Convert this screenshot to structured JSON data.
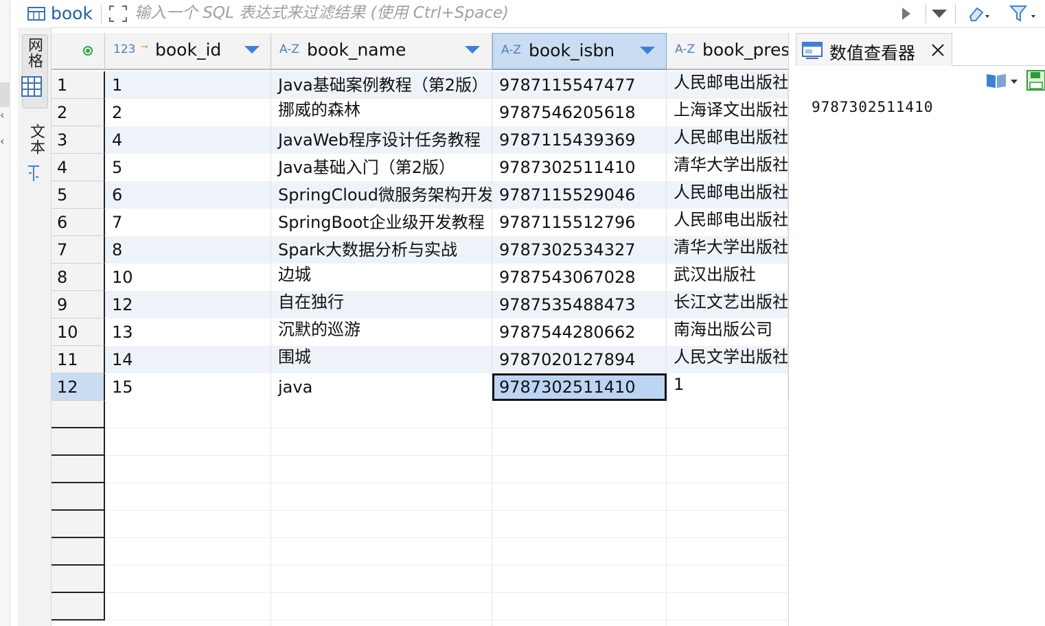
{
  "toolbar": {
    "table_name": "book",
    "filter_placeholder": "输入一个 SQL 表达式来过滤结果 (使用 Ctrl+Space)"
  },
  "side_tabs": {
    "grid_label": "网格",
    "text_label": "文本"
  },
  "columns": [
    {
      "type": "123",
      "name": "book_id",
      "key": true
    },
    {
      "type": "A-Z",
      "name": "book_name"
    },
    {
      "type": "A-Z",
      "name": "book_isbn"
    },
    {
      "type": "A-Z",
      "name": "book_pres"
    }
  ],
  "rows": [
    {
      "num": "1",
      "book_id": "1",
      "book_name": "Java基础案例教程（第2版）",
      "book_isbn": "9787115547477",
      "book_press": "人民邮电出版社"
    },
    {
      "num": "2",
      "book_id": "2",
      "book_name": "挪威的森林",
      "book_isbn": "9787546205618",
      "book_press": "上海译文出版社"
    },
    {
      "num": "3",
      "book_id": "4",
      "book_name": "JavaWeb程序设计任务教程",
      "book_isbn": "9787115439369",
      "book_press": "人民邮电出版社"
    },
    {
      "num": "4",
      "book_id": "5",
      "book_name": "Java基础入门（第2版）",
      "book_isbn": "9787302511410",
      "book_press": "清华大学出版社"
    },
    {
      "num": "5",
      "book_id": "6",
      "book_name": "SpringCloud微服务架构开发",
      "book_isbn": "9787115529046",
      "book_press": "人民邮电出版社"
    },
    {
      "num": "6",
      "book_id": "7",
      "book_name": "SpringBoot企业级开发教程",
      "book_isbn": "9787115512796",
      "book_press": "人民邮电出版社"
    },
    {
      "num": "7",
      "book_id": "8",
      "book_name": "Spark大数据分析与实战",
      "book_isbn": "9787302534327",
      "book_press": "清华大学出版社"
    },
    {
      "num": "8",
      "book_id": "10",
      "book_name": "边城",
      "book_isbn": "9787543067028",
      "book_press": "武汉出版社"
    },
    {
      "num": "9",
      "book_id": "12",
      "book_name": "自在独行",
      "book_isbn": "9787535488473",
      "book_press": "长江文艺出版社"
    },
    {
      "num": "10",
      "book_id": "13",
      "book_name": "沉默的巡游",
      "book_isbn": "9787544280662",
      "book_press": "南海出版公司"
    },
    {
      "num": "11",
      "book_id": "14",
      "book_name": "围城",
      "book_isbn": "9787020127894",
      "book_press": "人民文学出版社"
    },
    {
      "num": "12",
      "book_id": "15",
      "book_name": "java",
      "book_isbn": "9787302511410",
      "book_press": "1"
    }
  ],
  "selected": {
    "row": 12,
    "column": "book_isbn"
  },
  "value_viewer": {
    "title": "数值查看器",
    "value": "9787302511410"
  },
  "colors": {
    "accent": "#3b82d6",
    "selection": "#bcd5f5",
    "row_alt": "#eef3fa",
    "key_icon": "#e08a2a",
    "active_indicator": "#2faa3a"
  }
}
